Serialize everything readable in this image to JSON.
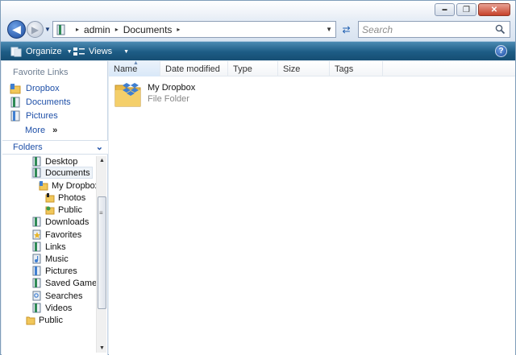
{
  "window": {
    "controls": {
      "minimize": "▬",
      "maximize": "❐",
      "close": "✕"
    }
  },
  "address_bar": {
    "breadcrumbs": [
      "admin",
      "Documents"
    ],
    "separator": "▸"
  },
  "search": {
    "placeholder": "Search"
  },
  "toolbar": {
    "organize_label": "Organize",
    "views_label": "Views",
    "help_label": "?"
  },
  "nav_pane": {
    "favorites_title": "Favorite Links",
    "favorites": [
      {
        "label": "Dropbox",
        "icon": "dropbox-folder-icon"
      },
      {
        "label": "Documents",
        "icon": "documents-icon"
      },
      {
        "label": "Pictures",
        "icon": "pictures-icon"
      }
    ],
    "more_label": "More",
    "more_glyph": "»",
    "folders_title": "Folders",
    "tree": [
      {
        "label": "Desktop",
        "icon": "desktop-icon",
        "indent": 1
      },
      {
        "label": "Documents",
        "icon": "documents-icon",
        "indent": 1,
        "selected": true
      },
      {
        "label": "My Dropbox",
        "icon": "dropbox-folder-icon",
        "indent": 2
      },
      {
        "label": "Photos",
        "icon": "photos-folder-icon",
        "indent": 3
      },
      {
        "label": "Public",
        "icon": "public-folder-icon",
        "indent": 3
      },
      {
        "label": "Downloads",
        "icon": "downloads-icon",
        "indent": 1
      },
      {
        "label": "Favorites",
        "icon": "favorites-icon",
        "indent": 1
      },
      {
        "label": "Links",
        "icon": "links-icon",
        "indent": 1
      },
      {
        "label": "Music",
        "icon": "music-icon",
        "indent": 1
      },
      {
        "label": "Pictures",
        "icon": "pictures-icon",
        "indent": 1
      },
      {
        "label": "Saved Games",
        "icon": "saved-games-icon",
        "indent": 1
      },
      {
        "label": "Searches",
        "icon": "searches-icon",
        "indent": 1
      },
      {
        "label": "Videos",
        "icon": "videos-icon",
        "indent": 1
      },
      {
        "label": "Public",
        "icon": "public-folder-icon",
        "indent": 0
      }
    ]
  },
  "content": {
    "columns": [
      "Name",
      "Date modified",
      "Type",
      "Size",
      "Tags"
    ],
    "items": [
      {
        "name": "My Dropbox",
        "kind": "File Folder",
        "icon": "dropbox-folder-icon"
      }
    ]
  },
  "colors": {
    "toolbar_top": "#4c8ab2",
    "toolbar_bottom": "#164e73",
    "link_blue": "#1f50a8",
    "folder_yellow": "#f1c75a"
  }
}
